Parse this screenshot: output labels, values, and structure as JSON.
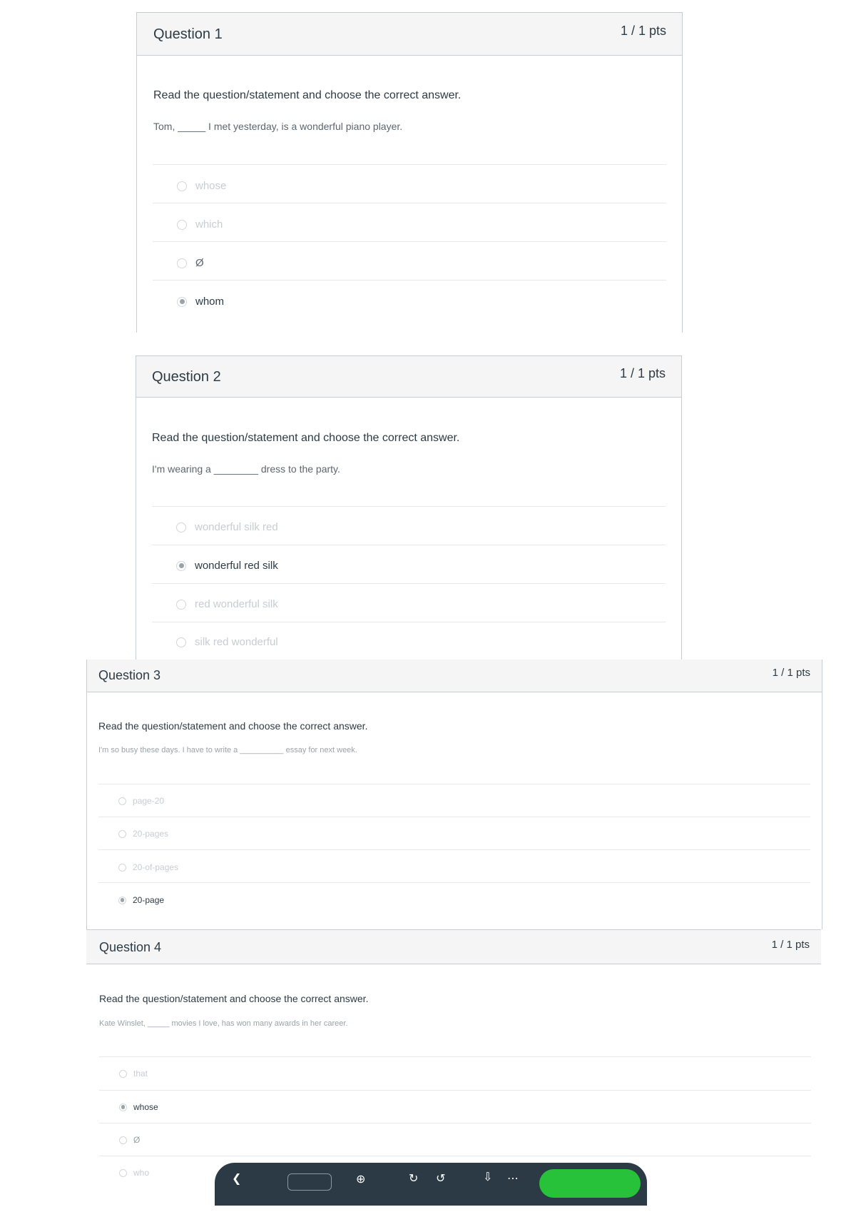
{
  "questions": [
    {
      "title": "Question 1",
      "points": "1 / 1 pts",
      "prompt": "Read the question/statement and choose the correct answer.",
      "stem": "Tom, _____ I met yesterday, is a wonderful piano player.",
      "answers": [
        "whose",
        "which",
        "Ø",
        "whom"
      ],
      "selected": "whom"
    },
    {
      "title": "Question 2",
      "points": "1 / 1 pts",
      "prompt": "Read the question/statement and choose the correct answer.",
      "stem": "I'm wearing a ________ dress to the party.",
      "answers": [
        "wonderful silk red",
        "wonderful red silk",
        "red wonderful silk",
        "silk red wonderful"
      ],
      "selected": "wonderful red silk"
    },
    {
      "title": "Question 3",
      "points": "1 / 1 pts",
      "prompt": "Read the question/statement and choose the correct answer.",
      "stem": "I'm so busy these days. I have to write a __________ essay for next week.",
      "answers": [
        "page-20",
        "20-pages",
        "20-of-pages",
        "20-page"
      ],
      "selected": "20-page"
    },
    {
      "title": "Question 4",
      "points": "1 / 1 pts",
      "prompt": "Read the question/statement and choose the correct answer.",
      "stem": "Kate Winslet, _____ movies I love, has won many awards in her career.",
      "answers": [
        "that",
        "whose",
        "Ø",
        "who"
      ],
      "selected": "whose"
    }
  ],
  "toolbar": {
    "icons": [
      "previous-page-icon",
      "page-number-field",
      "zoom-icon",
      "rotate-icon",
      "download-icon",
      "more-icon",
      "primary-action-button"
    ],
    "accent_color": "#27c13a",
    "background_color": "#2b3a44"
  }
}
